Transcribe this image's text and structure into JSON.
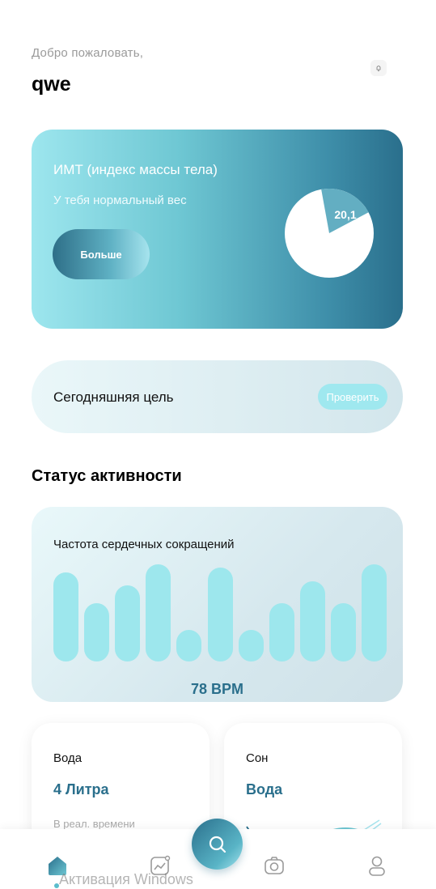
{
  "header": {
    "welcome": "Добро пожаловать,",
    "username": "qwe"
  },
  "bmi": {
    "title": "ИМТ (индекс массы тела)",
    "subtitle": "У тебя нормальный вес",
    "more_label": "Больше",
    "value": "20,1",
    "chart_fraction": 0.201
  },
  "goal": {
    "label": "Сегодняшняя цель",
    "check_label": "Проверить"
  },
  "activity": {
    "title": "Статус активности",
    "heart_rate": {
      "label": "Частота сердечных сокращений",
      "bpm": "78 BPM",
      "bars": [
        0.88,
        0.58,
        0.75,
        0.96,
        0.31,
        0.93,
        0.31,
        0.58,
        0.79,
        0.58,
        0.96
      ]
    }
  },
  "cards": {
    "water": {
      "title": "Вода",
      "value": "4 Литра",
      "note": "В реал. времени"
    },
    "sleep": {
      "title": "Сон",
      "value": "Вода"
    }
  },
  "colors": {
    "accent_dark": "#2a6f8c",
    "accent_light": "#9de7ed"
  },
  "watermark": "Активация Windows"
}
